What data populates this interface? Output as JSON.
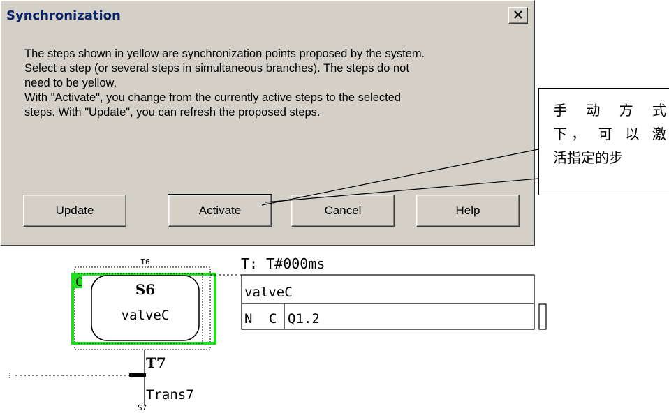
{
  "dialog": {
    "title": "Synchronization",
    "message_lines": [
      "The steps shown in yellow are synchronization points proposed by the system.",
      "Select a step (or several steps in simultaneous branches). The steps do not",
      "need to be yellow.",
      "With \"Activate\", you change from the currently active steps to the selected",
      "steps. With \"Update\", you can refresh the proposed steps."
    ],
    "buttons": {
      "update": "Update",
      "activate": "Activate",
      "cancel": "Cancel",
      "help": "Help"
    }
  },
  "callout": {
    "lines": [
      "手 动 方 式",
      "下， 可 以 激",
      "活指定的步"
    ]
  },
  "sfc": {
    "step_top_label": "T6",
    "step_marker": "C",
    "step_name": "S6",
    "step_comment": "valveC",
    "time_label": "T: T#000ms",
    "action_block_title": "valveC",
    "action_qualifier": "N",
    "action_flag": "C",
    "action_address": "Q1.2",
    "transition_name": "T7",
    "transition_comment": "Trans7",
    "next_step_label": "S7",
    "highlight_color": "#22dd22"
  }
}
